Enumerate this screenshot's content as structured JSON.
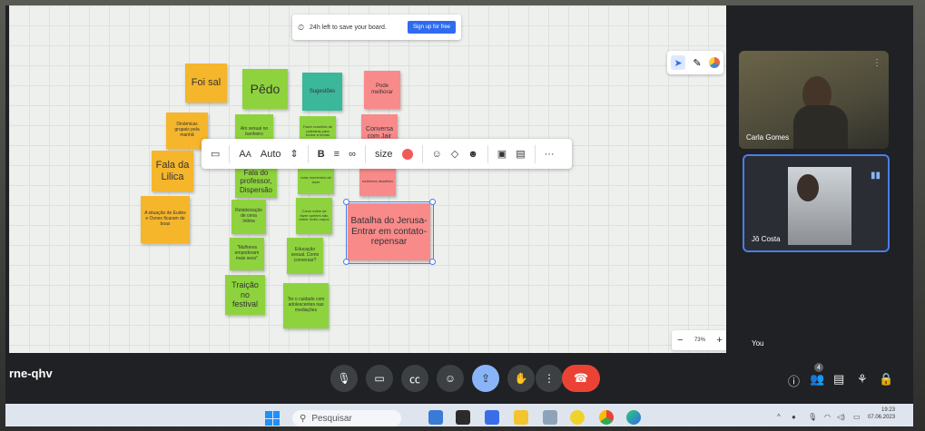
{
  "banner": {
    "clock_icon": "clock-icon",
    "text": "24h left to save your board.",
    "button": "Sign up for free"
  },
  "board_tools": {
    "icons": [
      "cursor-icon",
      "pen-icon",
      "color-picker-icon"
    ]
  },
  "stickies": {
    "foi_sal": "Foi sal",
    "pedo": "Pêdo",
    "sugestoes": "Sugestões",
    "pode_melhorar": "Pode melhorar",
    "dinamicas": "Dinâmicas grupais pela manhã",
    "fala_lilica": "Fala da Lilica",
    "situacao": "A situação de Eudes e Osnes ficaram de boas",
    "ato_sexual": "Ato sexual no banheiro",
    "fala_professor": "Fala do professor, Dispersão",
    "relativizacao": "Relativização de cena íntima",
    "mulheres": "\"Mulheres empoderam mais sexo\"",
    "traicao": "Traição no festival",
    "sugestao_teal": "Fazer reuniões de palestras para enviar a temas",
    "mais_momentos": "mais momentos de lazer",
    "como_evitar": "Como evitar de fazer queries não beber muito copos",
    "educacao": "Educação sexual. Como conversar?",
    "ter_cuidado": "Ter o cuidado com adolescentes nas mediações",
    "conversa_jair": "Conversa com Jair",
    "mulheres_desafiam": "mulheres desafiam",
    "batalha": "Batalha do Jerusa- Entrar em contato- repensar"
  },
  "toolbar": {
    "font_label": "Auto",
    "size_label": "size",
    "more": "···"
  },
  "zoom": {
    "minus": "−",
    "value": "73%",
    "plus": "+"
  },
  "participants": [
    {
      "name": "Carla Gomes"
    },
    {
      "name": "Jô Costa"
    }
  ],
  "you_label": "You",
  "meeting_code": "rne-qhv",
  "controls": [
    "mic",
    "camera",
    "captions",
    "emoji",
    "present",
    "raise-hand",
    "more"
  ],
  "people_count": "4",
  "taskbar": {
    "search_placeholder": "Pesquisar"
  },
  "clock": {
    "time": "19:23",
    "date": "07.06.2023"
  }
}
